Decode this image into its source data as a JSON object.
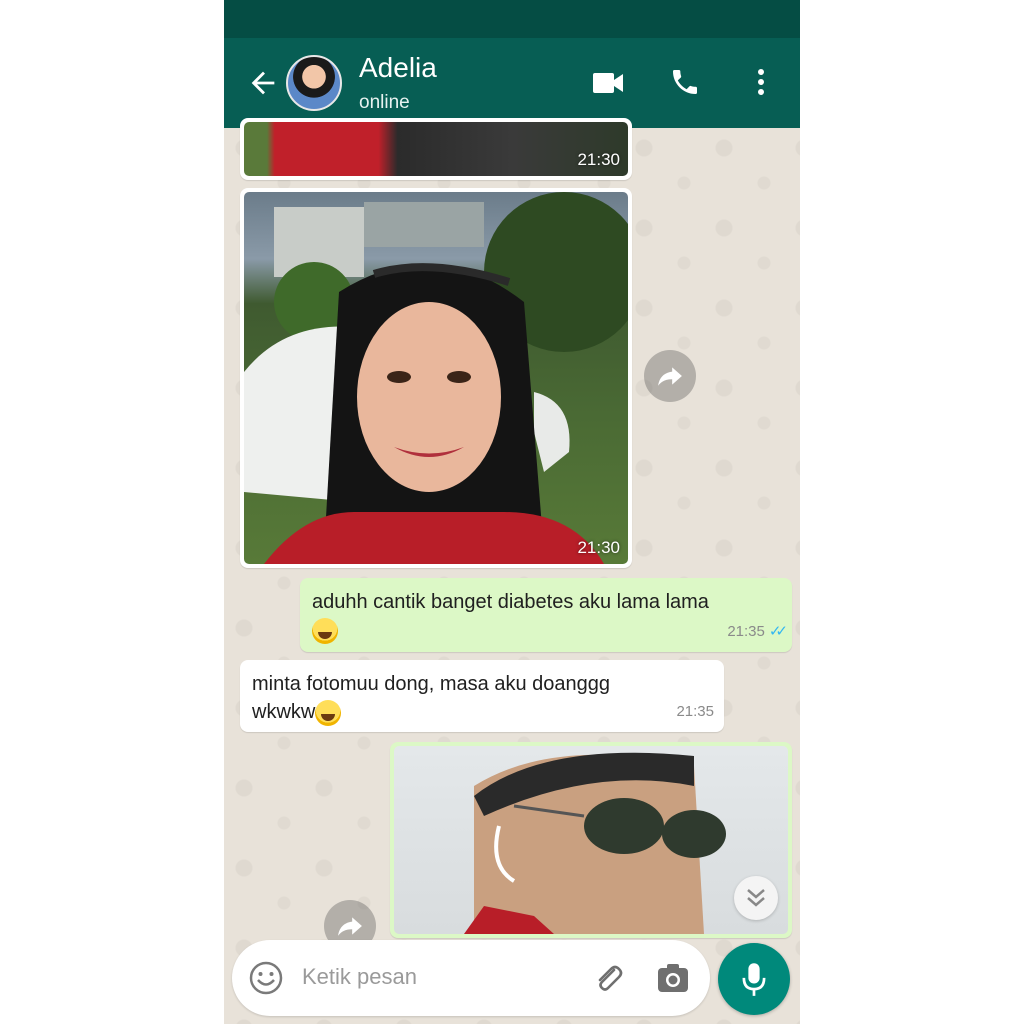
{
  "header": {
    "contact_name": "Adelia",
    "contact_status": "online",
    "icons": [
      "back-arrow-icon",
      "avatar",
      "video-call-icon",
      "phone-icon",
      "more-options-icon"
    ]
  },
  "messages": [
    {
      "type": "image",
      "direction": "incoming",
      "time": "21:30"
    },
    {
      "type": "image",
      "direction": "incoming",
      "time": "21:30"
    },
    {
      "type": "text",
      "direction": "outgoing",
      "text": "aduhh cantik banget diabetes aku lama lama",
      "emoji": "grinning-sweat-emoji",
      "time": "21:35",
      "status": "read"
    },
    {
      "type": "text",
      "direction": "incoming",
      "text": "minta fotomuu dong, masa aku doanggg",
      "text2": "wkwkw",
      "emoji": "laughing-emoji",
      "time": "21:35"
    },
    {
      "type": "image",
      "direction": "outgoing"
    }
  ],
  "composer": {
    "placeholder": "Ketik pesan",
    "icons": [
      "emoji-icon",
      "attach-icon",
      "camera-icon",
      "mic-icon"
    ]
  },
  "colors": {
    "header": "#075e54",
    "statusbar": "#054d44",
    "outgoing_bubble": "#dcf8c6",
    "incoming_bubble": "#ffffff",
    "wallpaper": "#e8e2d9",
    "fab": "#00897b",
    "read_ticks": "#34b7f1"
  }
}
